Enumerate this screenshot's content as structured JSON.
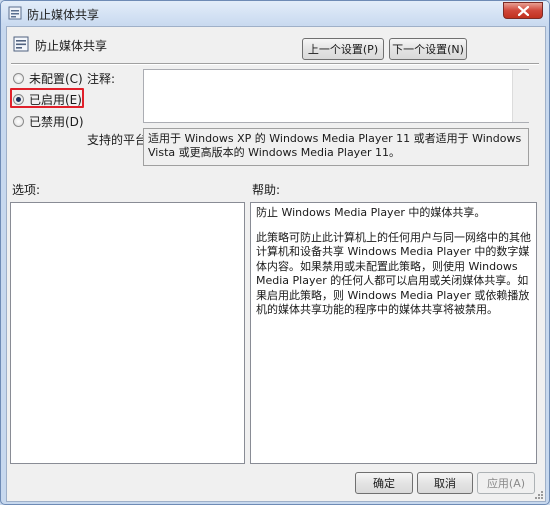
{
  "window": {
    "title": "防止媒体共享"
  },
  "header": {
    "policy_title": "防止媒体共享",
    "prev_label": "上一个设置(P)",
    "next_label": "下一个设置(N)"
  },
  "state": {
    "options": [
      {
        "label": "未配置(C)",
        "checked": false
      },
      {
        "label": "已启用(E)",
        "checked": true
      },
      {
        "label": "已禁用(D)",
        "checked": false
      }
    ],
    "selected": "已启用(E)"
  },
  "comment": {
    "label": "注释:",
    "value": ""
  },
  "supported": {
    "label": "支持的平台:",
    "text": "适用于 Windows XP 的 Windows Media Player 11 或者适用于 Windows Vista 或更高版本的 Windows Media Player 11。"
  },
  "options_section": {
    "label": "选项:"
  },
  "help_section": {
    "label": "帮助:",
    "paragraph1": "防止 Windows Media Player 中的媒体共享。",
    "paragraph2": "此策略可防止此计算机上的任何用户与同一网络中的其他计算机和设备共享 Windows Media Player 中的数字媒体内容。如果禁用或未配置此策略，则使用 Windows Media Player 的任何人都可以启用或关闭媒体共享。如果启用此策略，则 Windows Media Player 或依赖播放机的媒体共享功能的程序中的媒体共享将被禁用。"
  },
  "footer": {
    "ok_label": "确定",
    "cancel_label": "取消",
    "apply_label": "应用(A)"
  },
  "colors": {
    "highlight": "#e0202a",
    "close_button": "#c1311f"
  }
}
